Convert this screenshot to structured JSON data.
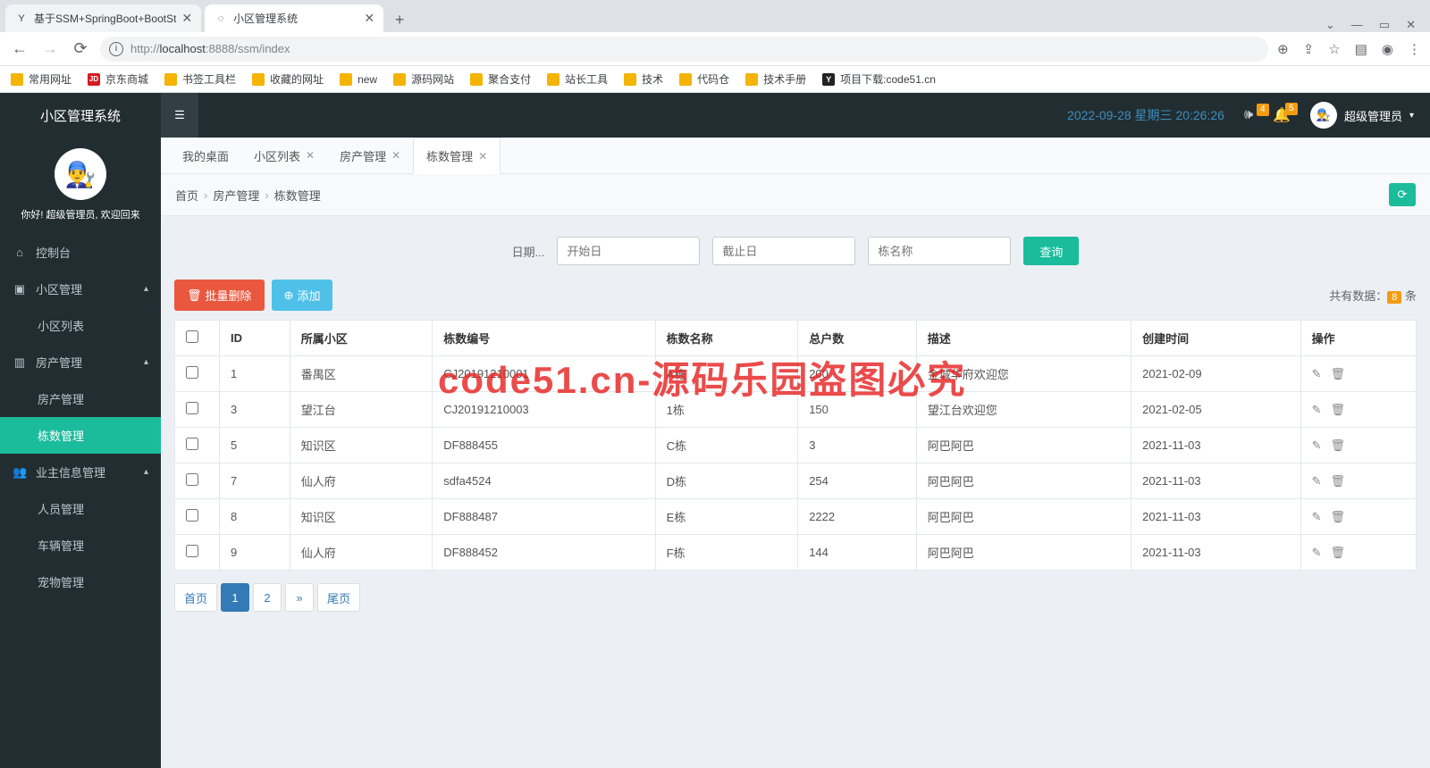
{
  "browser": {
    "tabs": [
      {
        "favicon": "Y",
        "title": "基于SSM+SpringBoot+BootSt"
      },
      {
        "favicon": "◌",
        "title": "小区管理系统",
        "active": true
      }
    ],
    "url_host": "localhost",
    "url_prefix": "http://",
    "url_port_path": ":8888/ssm/index",
    "bookmarks": [
      {
        "icon": "folder",
        "label": "常用网址"
      },
      {
        "icon": "jd",
        "label": "京东商城"
      },
      {
        "icon": "folder",
        "label": "书签工具栏"
      },
      {
        "icon": "folder",
        "label": "收藏的网址"
      },
      {
        "icon": "folder",
        "label": "new"
      },
      {
        "icon": "folder",
        "label": "源码网站"
      },
      {
        "icon": "folder",
        "label": "聚合支付"
      },
      {
        "icon": "folder",
        "label": "站长工具"
      },
      {
        "icon": "folder",
        "label": "技术"
      },
      {
        "icon": "folder",
        "label": "代码仓"
      },
      {
        "icon": "folder",
        "label": "技术手册"
      },
      {
        "icon": "y",
        "label": "项目下载:code51.cn"
      }
    ]
  },
  "header": {
    "brand": "小区管理系统",
    "datetime": "2022-09-28  星期三  20:26:26",
    "notif1_count": "4",
    "notif2_count": "5",
    "user_name": "超级管理员"
  },
  "sidebar": {
    "welcome": "你好! 超级管理员, 欢迎回来",
    "items": {
      "console": "控制台",
      "community": "小区管理",
      "community_list": "小区列表",
      "property": "房产管理",
      "property_mgmt": "房产管理",
      "building_mgmt": "栋数管理",
      "owner": "业主信息管理",
      "person": "人员管理",
      "vehicle": "车辆管理",
      "pet": "宠物管理"
    }
  },
  "page_tabs": [
    {
      "label": "我的桌面"
    },
    {
      "label": "小区列表",
      "closable": true
    },
    {
      "label": "房产管理",
      "closable": true
    },
    {
      "label": "栋数管理",
      "closable": true,
      "active": true
    }
  ],
  "breadcrumb": {
    "home": "首页",
    "p1": "房产管理",
    "p2": "栋数管理"
  },
  "search": {
    "date_label": "日期...",
    "start_placeholder": "开始日",
    "end_placeholder": "截止日",
    "name_placeholder": "栋名称",
    "query_btn": "查询"
  },
  "actions": {
    "batch_delete": "批量删除",
    "add": "添加",
    "count_prefix": "共有数据：",
    "count_num": "8",
    "count_suffix": " 条"
  },
  "table": {
    "headers": {
      "id": "ID",
      "community": "所属小区",
      "code": "栋数编号",
      "name": "栋数名称",
      "households": "总户数",
      "desc": "描述",
      "created": "创建时间",
      "ops": "操作"
    },
    "rows": [
      {
        "id": "1",
        "community": "番禺区",
        "code": "CJ20191210001",
        "name": "A栋",
        "households": "200",
        "desc": "金城华府欢迎您",
        "created": "2021-02-09"
      },
      {
        "id": "3",
        "community": "望江台",
        "code": "CJ20191210003",
        "name": "1栋",
        "households": "150",
        "desc": "望江台欢迎您",
        "created": "2021-02-05"
      },
      {
        "id": "5",
        "community": "知识区",
        "code": "DF888455",
        "name": "C栋",
        "households": "3",
        "desc": "阿巴阿巴",
        "created": "2021-11-03"
      },
      {
        "id": "7",
        "community": "仙人府",
        "code": "sdfa4524",
        "name": "D栋",
        "households": "254",
        "desc": "阿巴阿巴",
        "created": "2021-11-03"
      },
      {
        "id": "8",
        "community": "知识区",
        "code": "DF888487",
        "name": "E栋",
        "households": "2222",
        "desc": "阿巴阿巴",
        "created": "2021-11-03"
      },
      {
        "id": "9",
        "community": "仙人府",
        "code": "DF888452",
        "name": "F栋",
        "households": "144",
        "desc": "阿巴阿巴",
        "created": "2021-11-03"
      }
    ]
  },
  "pager": {
    "first": "首页",
    "p1": "1",
    "p2": "2",
    "next": "»",
    "last": "尾页"
  },
  "watermark": "code51.cn-源码乐园盗图必究"
}
